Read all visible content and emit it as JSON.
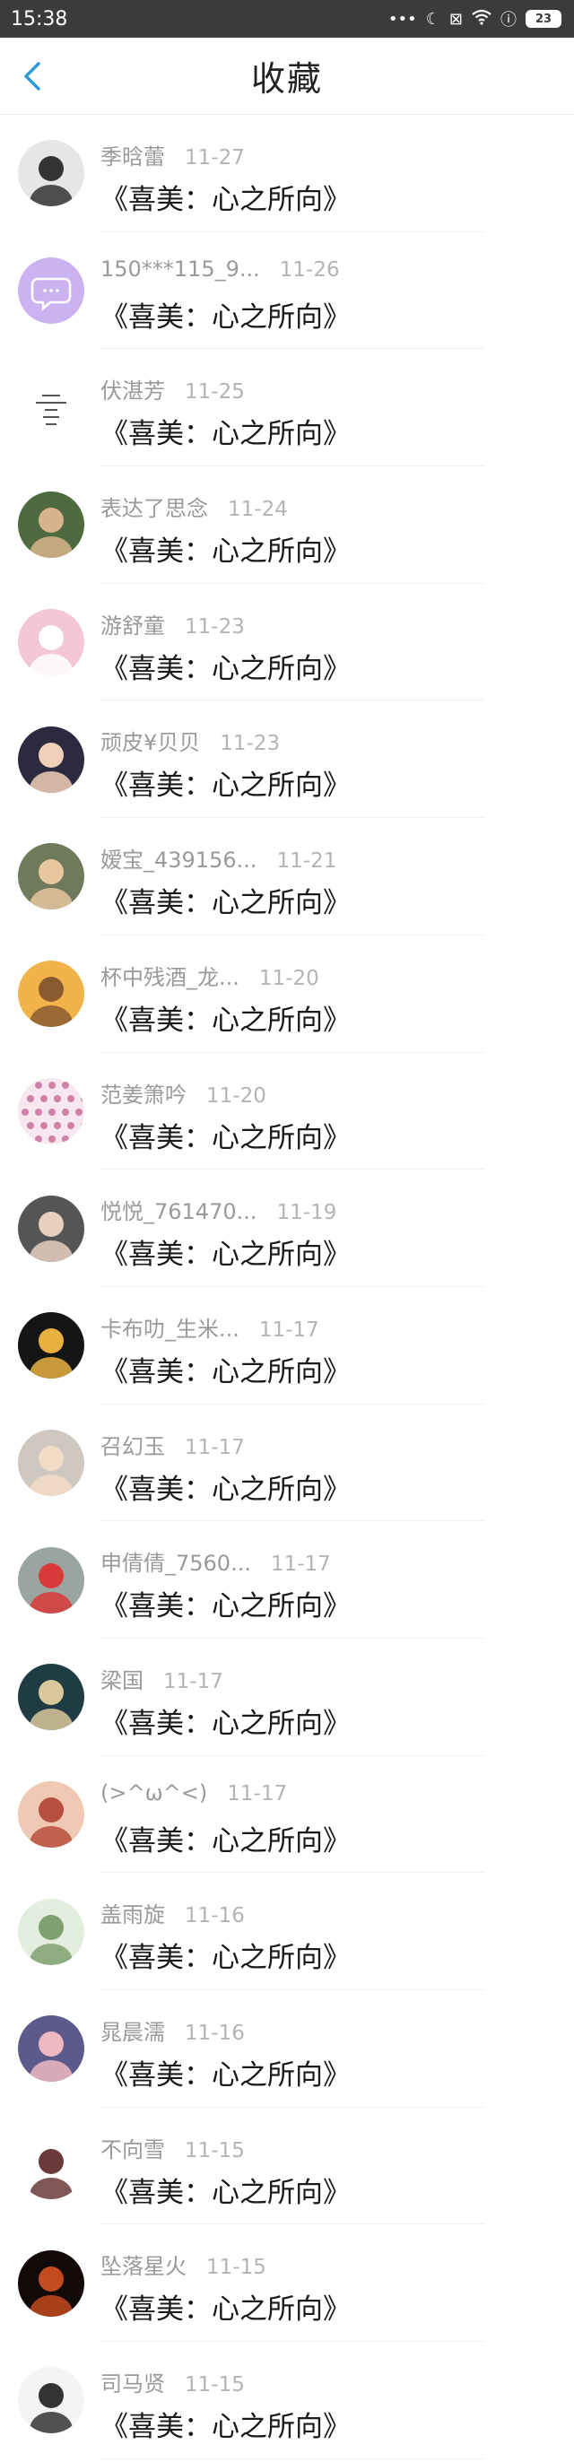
{
  "status": {
    "time": "15:38",
    "battery": "23"
  },
  "header": {
    "title": "收藏"
  },
  "items": [
    {
      "name": "季晗蕾",
      "time": "11-27",
      "book": "《喜美：心之所向》",
      "avatar": {
        "bg": "#e6e6e6",
        "fg": "#333333",
        "kind": "face"
      }
    },
    {
      "name": "150***115_9...",
      "time": "11-26",
      "book": "《喜美：心之所向》",
      "avatar": {
        "bg": "#cbb2f0",
        "fg": "#ffffff",
        "kind": "chat"
      }
    },
    {
      "name": "伏湛芳",
      "time": "11-25",
      "book": "《喜美：心之所向》",
      "avatar": {
        "bg": "#ffffff",
        "fg": "#555555",
        "kind": "text"
      }
    },
    {
      "name": "表达了思念",
      "time": "11-24",
      "book": "《喜美：心之所向》",
      "avatar": {
        "bg": "#4e6a3e",
        "fg": "#d9b38c",
        "kind": "face"
      }
    },
    {
      "name": "游舒童",
      "time": "11-23",
      "book": "《喜美：心之所向》",
      "avatar": {
        "bg": "#f3c7d8",
        "fg": "#ffffff",
        "kind": "face"
      }
    },
    {
      "name": "顽皮¥贝贝",
      "time": "11-23",
      "book": "《喜美：心之所向》",
      "avatar": {
        "bg": "#2c2a3e",
        "fg": "#f0d0b8",
        "kind": "face"
      }
    },
    {
      "name": "嫒宝_439156...",
      "time": "11-21",
      "book": "《喜美：心之所向》",
      "avatar": {
        "bg": "#6f7a5a",
        "fg": "#e8c7a0",
        "kind": "face"
      }
    },
    {
      "name": "杯中残酒_龙...",
      "time": "11-20",
      "book": "《喜美：心之所向》",
      "avatar": {
        "bg": "#f2b44a",
        "fg": "#8a5a30",
        "kind": "face"
      }
    },
    {
      "name": "范姜箫吟",
      "time": "11-20",
      "book": "《喜美：心之所向》",
      "avatar": {
        "bg": "#f7e7ef",
        "fg": "#c06090",
        "kind": "dots"
      }
    },
    {
      "name": "悦悦_761470...",
      "time": "11-19",
      "book": "《喜美：心之所向》",
      "avatar": {
        "bg": "#555555",
        "fg": "#e8d0c0",
        "kind": "face"
      }
    },
    {
      "name": "卡布叻_生米...",
      "time": "11-17",
      "book": "《喜美：心之所向》",
      "avatar": {
        "bg": "#151515",
        "fg": "#e8b040",
        "kind": "face"
      }
    },
    {
      "name": "召幻玉",
      "time": "11-17",
      "book": "《喜美：心之所向》",
      "avatar": {
        "bg": "#cfc8c0",
        "fg": "#f2dcc6",
        "kind": "face"
      }
    },
    {
      "name": "申倩倩_7560...",
      "time": "11-17",
      "book": "《喜美：心之所向》",
      "avatar": {
        "bg": "#9aa4a0",
        "fg": "#d83a3a",
        "kind": "face"
      }
    },
    {
      "name": "梁国",
      "time": "11-17",
      "book": "《喜美：心之所向》",
      "avatar": {
        "bg": "#1f3b44",
        "fg": "#d9c89a",
        "kind": "face"
      }
    },
    {
      "name": "(>^ω^<)",
      "time": "11-17",
      "book": "《喜美：心之所向》",
      "avatar": {
        "bg": "#efc9b4",
        "fg": "#b85040",
        "kind": "face"
      }
    },
    {
      "name": "盖雨旋",
      "time": "11-16",
      "book": "《喜美：心之所向》",
      "avatar": {
        "bg": "#e4eedf",
        "fg": "#7fa070",
        "kind": "face"
      }
    },
    {
      "name": "晁晨濡",
      "time": "11-16",
      "book": "《喜美：心之所向》",
      "avatar": {
        "bg": "#5b5a8a",
        "fg": "#f0b8c0",
        "kind": "face"
      }
    },
    {
      "name": "不向雪",
      "time": "11-15",
      "book": "《喜美：心之所向》",
      "avatar": {
        "bg": "#ffffff",
        "fg": "#6a3a3a",
        "kind": "face"
      }
    },
    {
      "name": "坠落星火",
      "time": "11-15",
      "book": "《喜美：心之所向》",
      "avatar": {
        "bg": "#120a08",
        "fg": "#c44a20",
        "kind": "face"
      }
    },
    {
      "name": "司马贤",
      "time": "11-15",
      "book": "《喜美：心之所向》",
      "avatar": {
        "bg": "#f4f4f4",
        "fg": "#333333",
        "kind": "face"
      }
    }
  ]
}
